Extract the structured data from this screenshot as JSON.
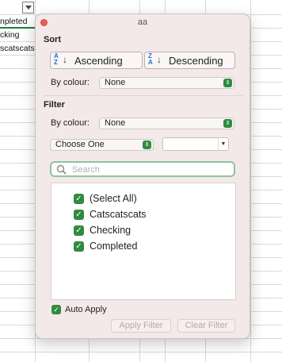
{
  "sheet": {
    "cells": [
      "npleted",
      "cking",
      "scatscats"
    ]
  },
  "popover": {
    "title": "aa",
    "sort": {
      "heading": "Sort",
      "ascending_label": "Ascending",
      "descending_label": "Descending",
      "ascending_glyph": "A\nZ",
      "descending_glyph": "Z\nA",
      "by_colour_label": "By colour:",
      "by_colour_value": "None"
    },
    "filter": {
      "heading": "Filter",
      "by_colour_label": "By colour:",
      "by_colour_value": "None",
      "condition_value": "Choose One",
      "value_field": ""
    },
    "search": {
      "placeholder": "Search"
    },
    "items": [
      {
        "label": "(Select All)",
        "checked": true
      },
      {
        "label": "Catscatscats",
        "checked": true
      },
      {
        "label": "Checking",
        "checked": true
      },
      {
        "label": "Completed",
        "checked": true
      }
    ],
    "auto_apply_label": "Auto Apply",
    "auto_apply_checked": true,
    "apply_filter_label": "Apply Filter",
    "clear_filter_label": "Clear Filter",
    "accent_color": "#2f8c41"
  }
}
